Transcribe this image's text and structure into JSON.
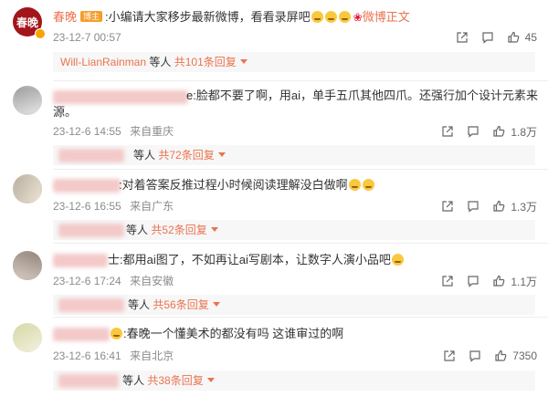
{
  "comments": [
    {
      "author": "春晚",
      "author_badge": "博主",
      "avatar_text": "春晚",
      "text": ":小编请大家移步最新微博，看看录屏吧",
      "text_tail": "微博正文",
      "time": "23-12-7 00:57",
      "location": "",
      "likes": "45",
      "replies": {
        "names": "Will-LianRainman",
        "and_others": "等人",
        "count": "共101条回复"
      }
    },
    {
      "text_visible": "e:脸都不要了啊，用ai，单手五爪其他四爪。还强行加个设计元素来",
      "text_line2": "源。",
      "time": "23-12-6 14:55",
      "location": "来自重庆",
      "likes": "1.8万",
      "replies": {
        "and_others": "等人",
        "count": "共72条回复"
      }
    },
    {
      "text_visible": ":对着答案反推过程小时候阅读理解没白做啊",
      "time": "23-12-6 16:55",
      "location": "来自广东",
      "likes": "1.3万",
      "replies": {
        "and_others": "等人",
        "count": "共52条回复"
      }
    },
    {
      "text_visible": "士:都用ai图了，不如再让ai写剧本，让数字人演小品吧",
      "time": "23-12-6 17:24",
      "location": "来自安徽",
      "likes": "1.1万",
      "replies": {
        "and_others": "等人",
        "count": "共56条回复"
      }
    },
    {
      "text_visible": ":春晚一个懂美术的都没有吗  这谁审过的啊",
      "time": "23-12-6 16:41",
      "location": "来自北京",
      "likes": "7350",
      "replies": {
        "and_others": "等人",
        "count": "共38条回复"
      }
    }
  ],
  "icons": [
    "share-icon",
    "comment-icon",
    "like-icon",
    "caret-down-icon",
    "emoji-icon",
    "weibo-logo-icon"
  ],
  "colors": {
    "author": "#eb7350",
    "badge": "#f59e2a",
    "meta": "#8b8b8b",
    "avatar_brand": "#a4141b"
  }
}
